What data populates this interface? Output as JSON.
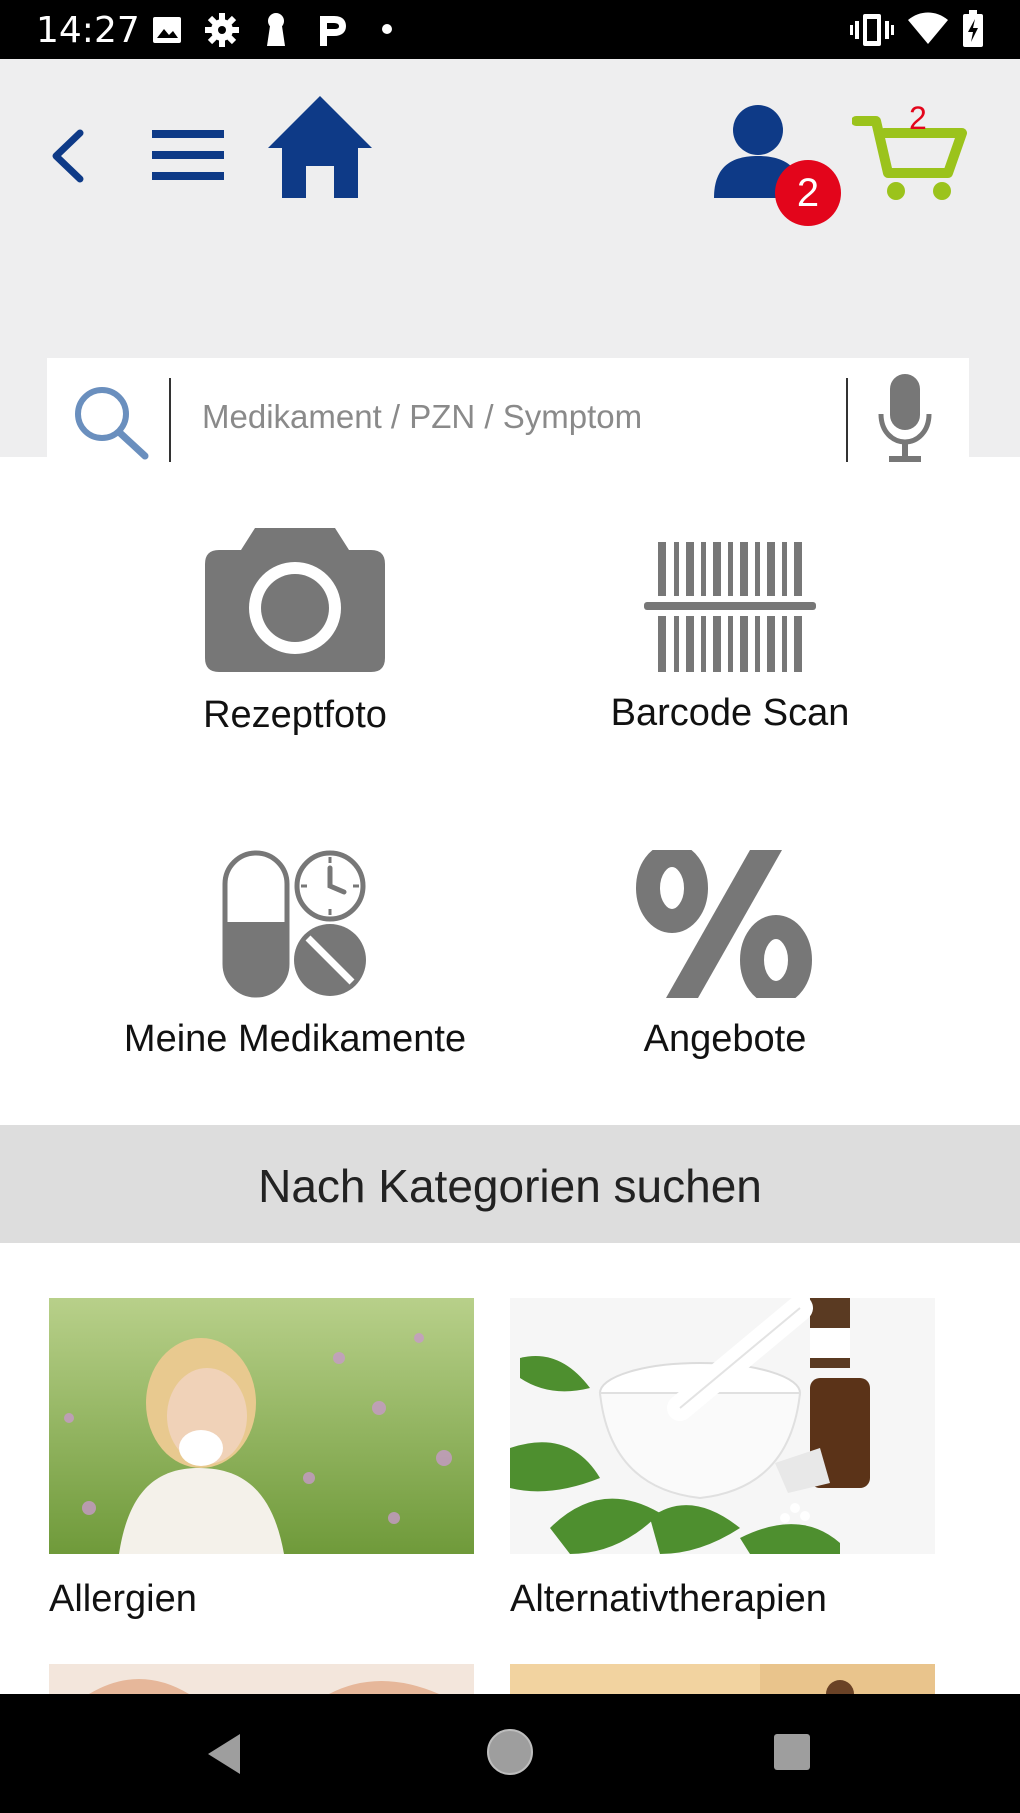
{
  "status_bar": {
    "time": "14:27",
    "icons_left": [
      "image-icon",
      "gear-icon",
      "keyhole-icon",
      "parking-icon",
      "dot-icon"
    ],
    "icons_right": [
      "vibrate-icon",
      "wifi-icon",
      "battery-icon"
    ]
  },
  "header": {
    "user_badge": "2",
    "cart_count": "2",
    "colors": {
      "brand_blue": "#0e3a87",
      "cart_green": "#9bc31c",
      "badge_red": "#e3051b"
    }
  },
  "search": {
    "placeholder": "Medikament / PZN / Symptom"
  },
  "tiles": [
    {
      "label": "Rezeptfoto",
      "icon": "camera-icon"
    },
    {
      "label": "Barcode Scan",
      "icon": "barcode-icon"
    },
    {
      "label": "Meine Medikamente",
      "icon": "pills-clock-icon"
    },
    {
      "label": "Angebote",
      "icon": "percent-icon"
    }
  ],
  "categories": {
    "title": "Nach Kategorien suchen",
    "items": [
      {
        "label": "Allergien"
      },
      {
        "label": "Alternativtherapien"
      }
    ]
  }
}
